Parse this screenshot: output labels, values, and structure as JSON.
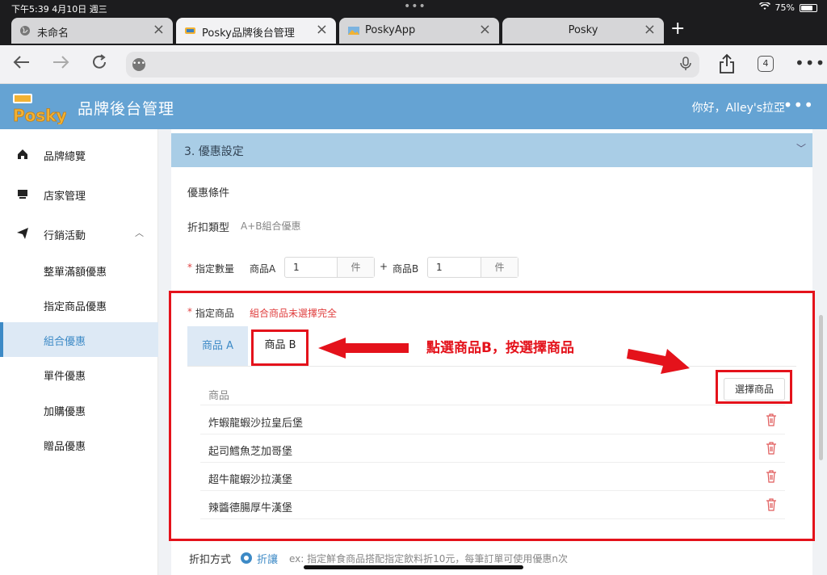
{
  "statusbar": {
    "time": "下午5:39  4月10日 週三",
    "battery": "75%",
    "battery_level": 0.75
  },
  "browser": {
    "tabs": [
      {
        "label": "未命名",
        "active": false
      },
      {
        "label": "Posky品牌後台管理",
        "active": true
      },
      {
        "label": "PoskyApp",
        "active": false
      },
      {
        "label": "Posky",
        "active": false
      }
    ],
    "tab_count": "4"
  },
  "header": {
    "title": "品牌後台管理",
    "greeting": "你好，Alley's拉亞"
  },
  "sidebar": {
    "items": [
      {
        "label": "品牌總覽"
      },
      {
        "label": "店家管理"
      },
      {
        "label": "行銷活動"
      }
    ],
    "subitems": [
      {
        "label": "整單滿額優惠"
      },
      {
        "label": "指定商品優惠"
      },
      {
        "label": "組合優惠"
      },
      {
        "label": "單件優惠"
      },
      {
        "label": "加購優惠"
      },
      {
        "label": "贈品優惠"
      }
    ]
  },
  "section": {
    "title": "3. 優惠設定"
  },
  "form": {
    "condition_title": "優惠條件",
    "discount_type_label": "折扣類型",
    "discount_type_value": "A+B組合優惠",
    "quantity_label": "指定數量",
    "product_a_label": "商品A",
    "product_a_qty": "1",
    "plus": "+",
    "product_b_label": "商品B",
    "product_b_qty": "1",
    "unit": "件",
    "products_label": "指定商品",
    "products_error": "組合商品未選擇完全",
    "tab_a": "商品 A",
    "tab_b": "商品 B",
    "annotation": "點選商品B，按選擇商品",
    "column_header": "商品",
    "select_button": "選擇商品",
    "products": [
      "炸蝦龍蝦沙拉皇后堡",
      "起司鱈魚芝加哥堡",
      "超牛龍蝦沙拉漢堡",
      "辣醬德腸厚牛漢堡"
    ],
    "method_label": "折扣方式",
    "method_option": "折讓",
    "method_hint": "ex: 指定鮮食商品搭配指定飲料折10元，每筆訂單可使用優惠n次"
  },
  "colors": {
    "header": "#65a3d3",
    "accent": "#3d8ac6",
    "annotation": "#e4121b"
  }
}
